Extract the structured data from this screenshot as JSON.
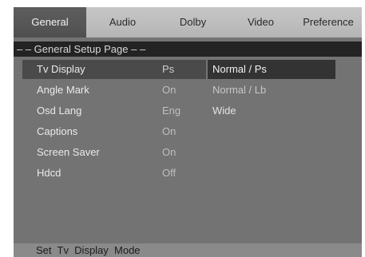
{
  "tabs": [
    "General",
    "Audio",
    "Dolby",
    "Video",
    "Preference"
  ],
  "active_tab": "General",
  "page_header": "– – General Setup Page – –",
  "settings": [
    {
      "label": "Tv Display",
      "value": "Ps"
    },
    {
      "label": "Angle Mark",
      "value": "On"
    },
    {
      "label": "Osd Lang",
      "value": "Eng"
    },
    {
      "label": "Captions",
      "value": "On"
    },
    {
      "label": "Screen Saver",
      "value": "On"
    },
    {
      "label": "Hdcd",
      "value": "Off"
    }
  ],
  "options": [
    "Normal / Ps",
    "Normal / Lb",
    "Wide"
  ],
  "status": "Set  Tv  Display  Mode"
}
